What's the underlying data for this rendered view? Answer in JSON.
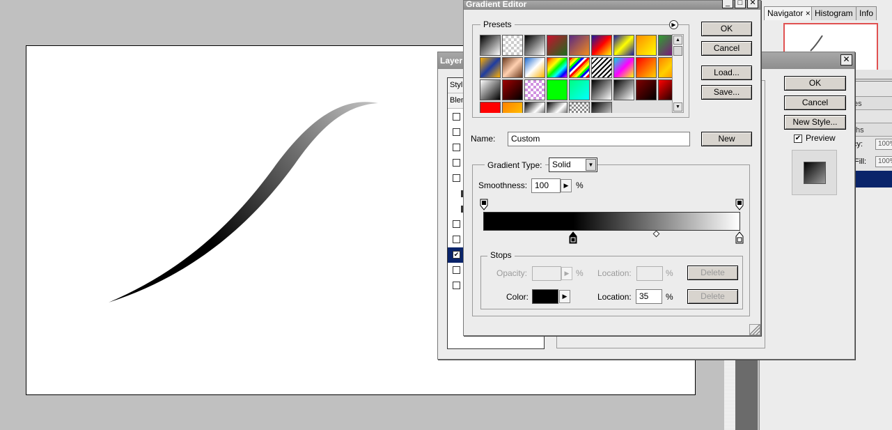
{
  "gradient_editor": {
    "title": "Gradient Editor",
    "window_buttons": {
      "minimize": "_",
      "maximize": "□",
      "close": "✕"
    },
    "presets_label": "Presets",
    "buttons": {
      "ok": "OK",
      "cancel": "Cancel",
      "load": "Load...",
      "save": "Save...",
      "new": "New"
    },
    "name_label": "Name:",
    "name_value": "Custom",
    "gradient_type_label": "Gradient Type:",
    "gradient_type_value": "Solid",
    "smoothness_label": "Smoothness:",
    "smoothness_value": "100",
    "percent": "%",
    "stops": {
      "label": "Stops",
      "opacity_label": "Opacity:",
      "opacity_value": "",
      "opacity_location_label": "Location:",
      "opacity_location_value": "",
      "color_label": "Color:",
      "color_value": "#000000",
      "color_location_label": "Location:",
      "color_location_value": "35",
      "delete_label": "Delete"
    },
    "color_stop_location_pct": 35,
    "presets": [
      "linear-gradient(135deg,#000,#fff)",
      "repeating-conic-gradient(#ccc 0 25%,#fff 0 50%) 0 0/8px 8px",
      "linear-gradient(135deg,#000,#fff)",
      "linear-gradient(135deg,#c8102e,#1e6b1e)",
      "linear-gradient(135deg,#5a2a82,#f28c1e)",
      "linear-gradient(135deg,#1a1aa0,#ff0000,#ffff00)",
      "linear-gradient(135deg,#1a1aa0,#ffff00,#1a1aa0)",
      "linear-gradient(135deg,#ff8c00,#ffff00)",
      "linear-gradient(135deg,#2ea02e,#8b008b)",
      "linear-gradient(135deg,#ffb000,#1e3ca0,#ffb000)",
      "linear-gradient(135deg,#6b3a1e,#ffd0b0,#6b3a1e)",
      "linear-gradient(135deg,#1e6ad0,#fff,#ffb000)",
      "linear-gradient(135deg,red,orange,yellow,lime,cyan,blue,magenta)",
      "repeating-linear-gradient(135deg,red 0 3px,orange 3px 6px,yellow 6px 9px,lime 9px 12px,blue 12px 15px,#fff 15px 18px)",
      "repeating-linear-gradient(135deg,#000 0 2px,#fff 2px 5px)",
      "linear-gradient(135deg,#00e0e0,#ff00ff,#ffff00)",
      "linear-gradient(135deg,#ff0000,#ffd000)",
      "linear-gradient(135deg,#ff8000,#ffd000,#ff8000)",
      "linear-gradient(135deg,#fff,#000)",
      "linear-gradient(135deg,#a00000,#000)",
      "repeating-conic-gradient(#d090e0 0 25%,#fff 0 50%) 0 0/8px 8px",
      "linear-gradient(135deg,#00ff00,#00ff00)",
      "linear-gradient(135deg,#00ff80,#00ffff)",
      "linear-gradient(135deg,#000,#fff)",
      "linear-gradient(135deg,#000,#fff)",
      "linear-gradient(135deg,#800000,#000)",
      "linear-gradient(135deg,#ff0000,#000)",
      "linear-gradient(135deg,#ff0000,#ff0000)",
      "linear-gradient(135deg,#ff8000,#ffd000)",
      "linear-gradient(135deg,#000,#fff,#000)",
      "linear-gradient(135deg,#000,#fff,#000)",
      "repeating-conic-gradient(#888 0 25%,#fff 0 50%) 0 0/6px 6px",
      "linear-gradient(135deg,#000,#fff)"
    ]
  },
  "layer_style": {
    "title": "Layer",
    "close": "✕",
    "list_header_1": "Styl",
    "list_header_2": "Blen",
    "buttons": {
      "ok": "OK",
      "cancel": "Cancel",
      "new_style": "New Style..."
    },
    "preview_label": "Preview",
    "preview_checked": "✔",
    "row_checked": "✔"
  },
  "navigator": {
    "tabs": [
      "Navigator",
      "Histogram",
      "Info"
    ],
    "tab_close": "×",
    "mini_tabs": [
      "es",
      "ths"
    ],
    "opacity_suffix": "cy:",
    "opacity_value": "100%",
    "fill_suffix": "Fill:",
    "fill_value": "100%"
  },
  "colors": {
    "selection": "#0a246a",
    "canvas": "#ffffff",
    "workspace": "#c0c0c0"
  }
}
